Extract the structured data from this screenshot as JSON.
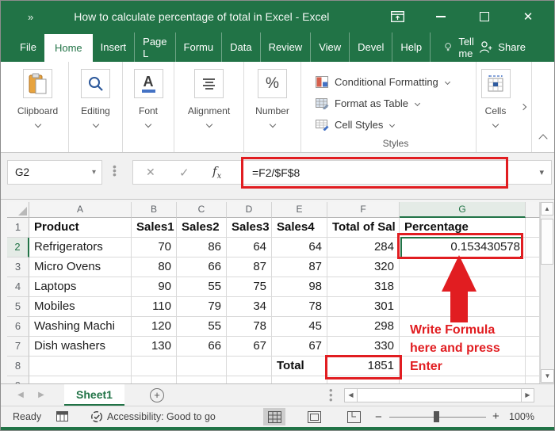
{
  "window": {
    "title": "How to calculate percentage of total in Excel  -  Excel",
    "quick_access_chevron": "»"
  },
  "titlebar_icons": {
    "ribbon_display_options": "ribbon-display-options-icon",
    "minimize": "minimize-icon",
    "maximize": "maximize-icon",
    "close": "✕"
  },
  "ribbon_tabs": {
    "items": [
      {
        "label": "File",
        "active": false
      },
      {
        "label": "Home",
        "active": true
      },
      {
        "label": "Insert",
        "active": false
      },
      {
        "label": "Page L",
        "active": false
      },
      {
        "label": "Formu",
        "active": false
      },
      {
        "label": "Data",
        "active": false
      },
      {
        "label": "Review",
        "active": false
      },
      {
        "label": "View",
        "active": false
      },
      {
        "label": "Devel",
        "active": false
      },
      {
        "label": "Help",
        "active": false
      }
    ],
    "tell_me": "Tell me",
    "share": "Share"
  },
  "ribbon": {
    "groups": [
      {
        "label": "Clipboard",
        "icon": "clipboard-icon"
      },
      {
        "label": "Editing",
        "icon": "search-icon"
      },
      {
        "label": "Font",
        "icon": "font-icon"
      },
      {
        "label": "Alignment",
        "icon": "alignment-icon"
      },
      {
        "label": "Number",
        "icon": "percent-icon"
      }
    ],
    "styles_group": {
      "items": [
        "Conditional Formatting",
        "Format as Table",
        "Cell Styles"
      ],
      "caption": "Styles"
    },
    "cells_group": {
      "label": "Cells"
    }
  },
  "formula_bar": {
    "name_box": "G2",
    "formula": "=F2/$F$8"
  },
  "grid": {
    "columns": [
      "A",
      "B",
      "C",
      "D",
      "E",
      "F",
      "G"
    ],
    "selected_cell": "G2",
    "selected_column": "G",
    "selected_row": "2",
    "rows": [
      {
        "num": "1",
        "bold": true,
        "cells": [
          "Product",
          "Sales1",
          "Sales2",
          "Sales3",
          "Sales4",
          "Total of Sal",
          "Percentage"
        ]
      },
      {
        "num": "2",
        "cells": [
          "Refrigerators",
          "70",
          "86",
          "64",
          "64",
          "284",
          "0.153430578"
        ]
      },
      {
        "num": "3",
        "cells": [
          "Micro Ovens",
          "80",
          "66",
          "87",
          "87",
          "320",
          ""
        ]
      },
      {
        "num": "4",
        "cells": [
          "Laptops",
          "90",
          "55",
          "75",
          "98",
          "318",
          ""
        ]
      },
      {
        "num": "5",
        "cells": [
          "Mobiles",
          "110",
          "79",
          "34",
          "78",
          "301",
          ""
        ]
      },
      {
        "num": "6",
        "cells": [
          "Washing Machi",
          "120",
          "55",
          "78",
          "45",
          "298",
          ""
        ]
      },
      {
        "num": "7",
        "cells": [
          "Dish washers",
          "130",
          "66",
          "67",
          "67",
          "330",
          ""
        ]
      },
      {
        "num": "8",
        "cells": [
          "",
          "",
          "",
          "",
          "Total",
          "1851",
          ""
        ]
      },
      {
        "num": "9",
        "cells": [
          "",
          "",
          "",
          "",
          "",
          "",
          ""
        ]
      }
    ]
  },
  "annotation": {
    "lines": [
      "Write Formula",
      "here and press",
      "Enter"
    ]
  },
  "sheet_bar": {
    "active_tab": "Sheet1"
  },
  "status_bar": {
    "ready": "Ready",
    "accessibility": "Accessibility: Good to go",
    "zoom_value": "100%"
  },
  "colors": {
    "excel_green": "#217346",
    "annotation_red": "#e11d21",
    "selection_green": "#217346"
  }
}
